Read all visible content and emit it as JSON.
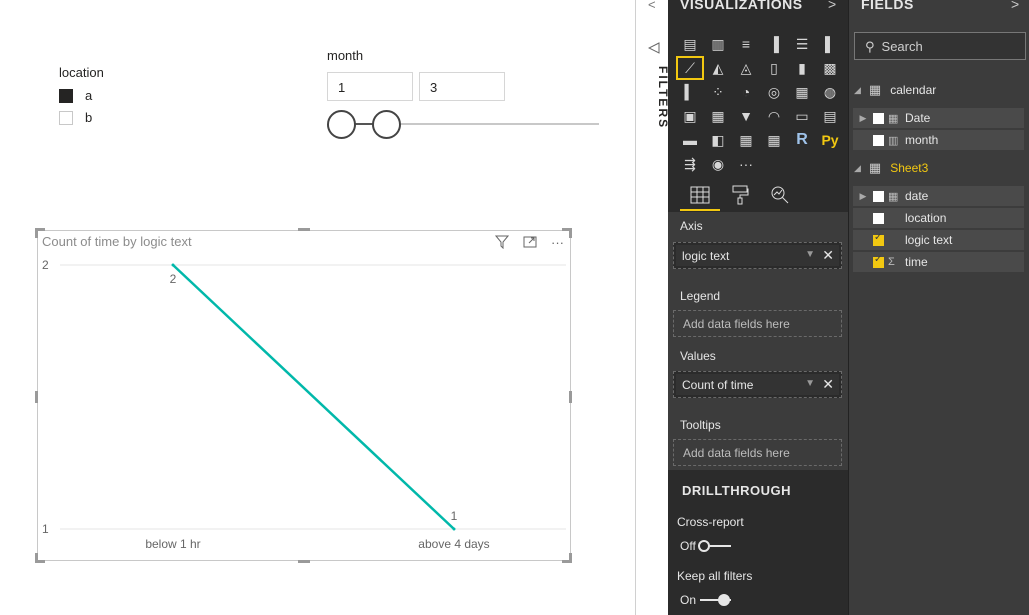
{
  "canvas": {
    "location_slicer": {
      "title": "location",
      "items": [
        {
          "label": "a",
          "checked": true
        },
        {
          "label": "b",
          "checked": false
        }
      ]
    },
    "month_slicer": {
      "title": "month",
      "min_value": "1",
      "max_value": "3"
    },
    "visual": {
      "title": "Count of time by logic text",
      "filter_icon": "filter-icon",
      "focus_icon": "focus-mode-icon",
      "more_icon": "more-options-icon",
      "more_glyph": "···"
    }
  },
  "chart_data": {
    "type": "line",
    "title": "Count of time by logic text",
    "categories": [
      "below 1 hr",
      "above 4 days"
    ],
    "series": [
      {
        "values": [
          2,
          1
        ],
        "color": "#01b8aa"
      }
    ],
    "data_labels": [
      "2",
      "1"
    ],
    "yticks": [
      "1",
      "2"
    ],
    "ylim": [
      1,
      2
    ],
    "grid": true,
    "xlabel": "",
    "ylabel": ""
  },
  "filters_strip": {
    "label": "FILTERS",
    "collapse_glyph": "<"
  },
  "visualizations": {
    "header": "VISUALIZATIONS",
    "expand_glyph": ">",
    "icons": [
      "▤",
      "▥",
      "≡",
      "▐",
      "☰",
      "▌",
      "⟋",
      "◭",
      "◬",
      "▯",
      "▮",
      "▩",
      "▍",
      "⁘",
      "◔",
      "◎",
      "▦",
      "◍",
      "▣",
      "▦",
      "▼",
      "◠",
      "▭",
      "▤",
      "▬",
      "◧",
      "▦",
      "▦",
      "R",
      "Py",
      "⇶",
      "◉",
      "···"
    ],
    "selected_index": 6,
    "tabs": [
      "fields-tab-icon",
      "format-paint-icon",
      "analytics-icon"
    ],
    "wells": {
      "axis_label": "Axis",
      "axis_field": "logic text",
      "legend_label": "Legend",
      "legend_placeholder": "Add data fields here",
      "values_label": "Values",
      "values_field": "Count of time",
      "tooltips_label": "Tooltips",
      "tooltips_placeholder": "Add data fields here"
    },
    "drillthrough": {
      "title": "DRILLTHROUGH",
      "cross_report_label": "Cross-report",
      "cross_report_state": "Off",
      "keep_filters_label": "Keep all filters",
      "keep_filters_state": "On"
    }
  },
  "fields": {
    "header": "FIELDS",
    "expand_glyph": ">",
    "search_placeholder": "Search",
    "tables": [
      {
        "name": "calendar",
        "fields": [
          {
            "name": "Date",
            "checked": false,
            "icon": "hierarchy"
          },
          {
            "name": "month",
            "checked": false,
            "icon": "hierarchy"
          }
        ]
      },
      {
        "name": "Sheet3",
        "fields": [
          {
            "name": "date",
            "checked": false,
            "icon": "hierarchy"
          },
          {
            "name": "location",
            "checked": false,
            "icon": ""
          },
          {
            "name": "logic text",
            "checked": true,
            "icon": ""
          },
          {
            "name": "time",
            "checked": true,
            "icon": "sigma"
          }
        ]
      }
    ]
  }
}
